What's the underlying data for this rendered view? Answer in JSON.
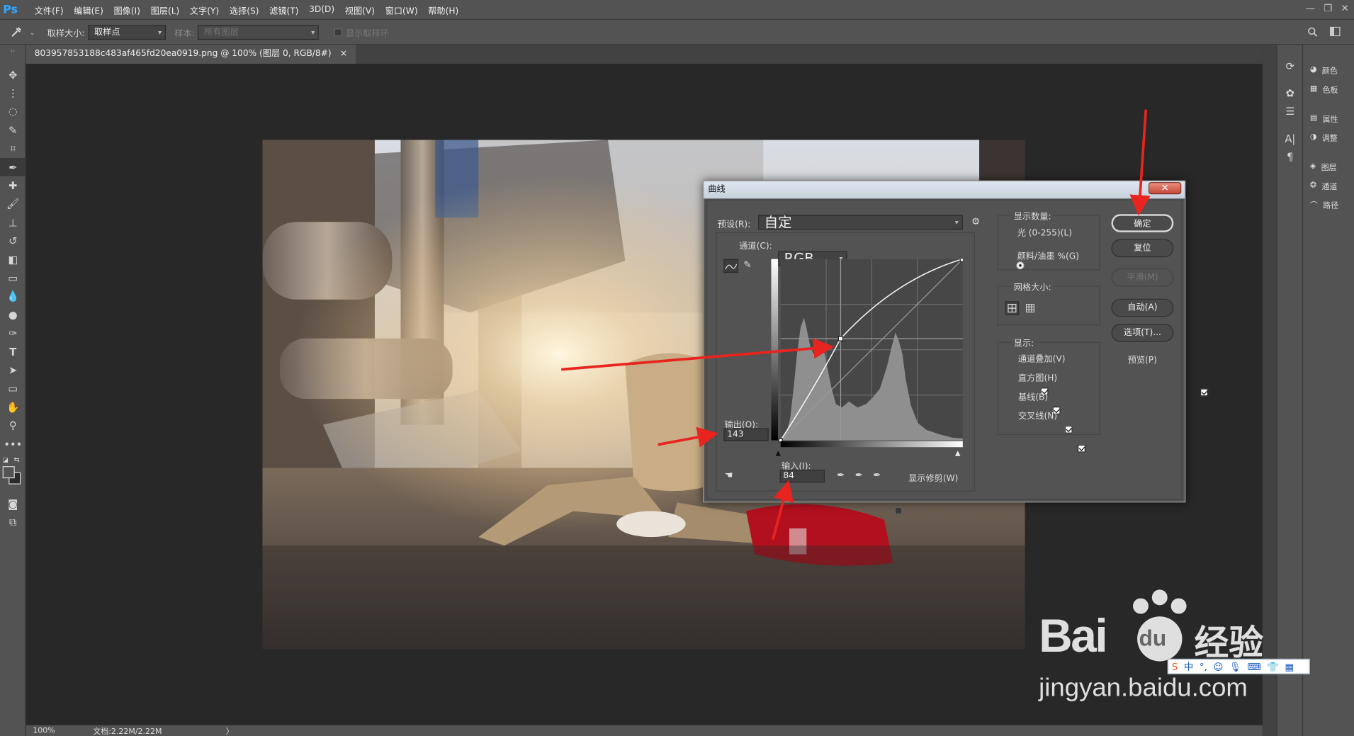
{
  "app": {
    "logo": "Ps"
  },
  "menu": [
    "文件(F)",
    "编辑(E)",
    "图像(I)",
    "图层(L)",
    "文字(Y)",
    "选择(S)",
    "滤镜(T)",
    "3D(D)",
    "视图(V)",
    "窗口(W)",
    "帮助(H)"
  ],
  "window_controls": [
    "—",
    "❐",
    "✕"
  ],
  "options_bar": {
    "sample_size_label": "取样大小:",
    "sample_size_value": "取样点",
    "sample_label": "样本:",
    "sample_value": "所有图层",
    "show_ring_label": "显示取样环"
  },
  "document_tab": {
    "title": "803957853188c483af465fd20ea0919.png @ 100% (图层 0, RGB/8#)",
    "close": "×"
  },
  "status": {
    "zoom": "100%",
    "doc": "文档:2.22M/2.22M",
    "arrow": "〉"
  },
  "right_panels": [
    {
      "icon": "color-icon",
      "label": "颜色"
    },
    {
      "icon": "swatches-icon",
      "label": "色板"
    },
    {
      "icon": "properties-icon",
      "label": "属性"
    },
    {
      "icon": "adjustments-icon",
      "label": "调整"
    },
    {
      "icon": "layers-icon",
      "label": "图层"
    },
    {
      "icon": "channels-icon",
      "label": "通道"
    },
    {
      "icon": "paths-icon",
      "label": "路径"
    }
  ],
  "curves_dialog": {
    "title": "曲线",
    "close": "✕",
    "preset_label": "预设(R):",
    "preset_value": "自定",
    "channel_label": "通道(C):",
    "channel_value": "RGB",
    "output_label": "输出(O):",
    "output_value": "143",
    "input_label": "输入(I):",
    "input_value": "84",
    "show_clipping_label": "显示修剪(W)",
    "show_amount": {
      "title": "显示数量:",
      "options": [
        "光 (0-255)(L)",
        "颜料/油墨 %(G)"
      ],
      "selected": 0
    },
    "grid_size_label": "网格大小:",
    "show": {
      "title": "显示:",
      "options": [
        "通道叠加(V)",
        "直方图(H)",
        "基线(B)",
        "交叉线(N)"
      ]
    },
    "buttons": {
      "ok": "确定",
      "reset": "复位",
      "smooth": "平滑(M)",
      "auto": "自动(A)",
      "options": "选项(T)..."
    },
    "preview_label": "预览(P)",
    "curve_point": {
      "input": 84,
      "output": 143
    }
  },
  "watermark": {
    "brand": "Bai",
    "du": "du",
    "jingyan": "经验",
    "url": "jingyan.baidu.com"
  },
  "ime_bar": {
    "mode": "中"
  },
  "colors": {
    "chrome": "#535353",
    "canvas": "#282828",
    "annotation_arrow": "#e8241e",
    "ps_blue": "#31a8ff"
  }
}
